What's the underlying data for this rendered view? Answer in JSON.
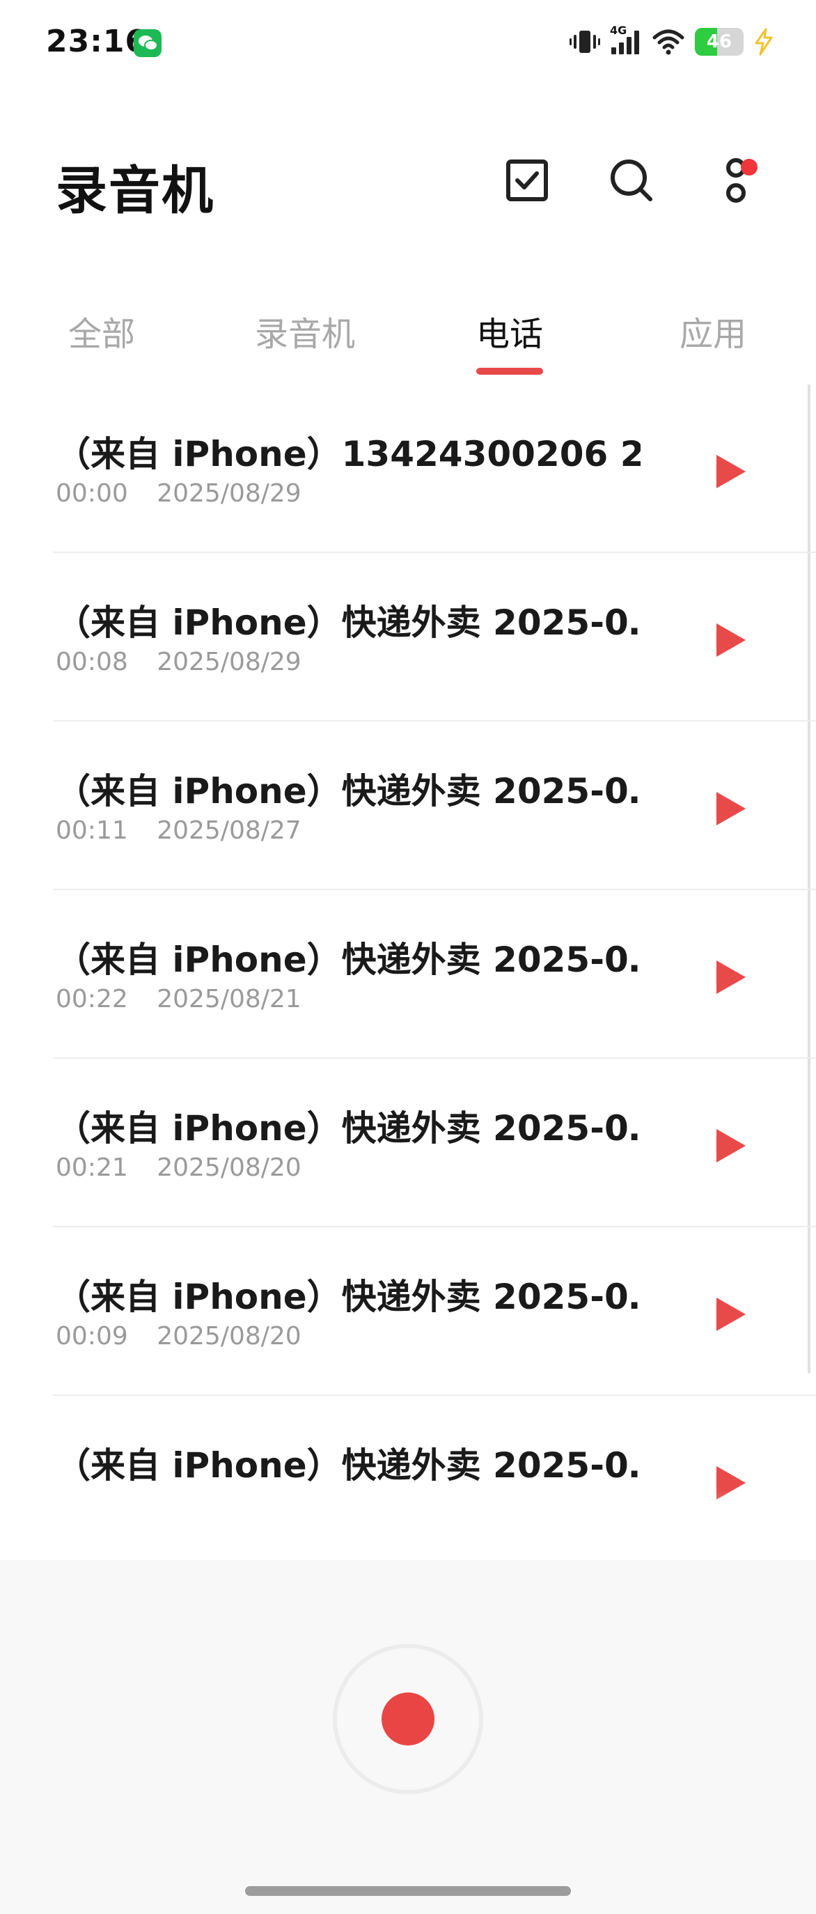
{
  "status_bar": {
    "time": "23:16",
    "network_label": "4G",
    "battery_level": "46",
    "battery_fraction": 0.46
  },
  "header": {
    "title": "录音机"
  },
  "tabs": [
    {
      "label": "全部",
      "active": false
    },
    {
      "label": "录音机",
      "active": false
    },
    {
      "label": "电话",
      "active": true
    },
    {
      "label": "应用",
      "active": false
    }
  ],
  "recordings": [
    {
      "title": "（来自 iPhone）13424300206 2…",
      "duration": "00:00",
      "date": "2025/08/29"
    },
    {
      "title": "（来自 iPhone）快递外卖 2025-0…",
      "duration": "00:08",
      "date": "2025/08/29"
    },
    {
      "title": "（来自 iPhone）快递外卖 2025-0…",
      "duration": "00:11",
      "date": "2025/08/27"
    },
    {
      "title": "（来自 iPhone）快递外卖 2025-0…",
      "duration": "00:22",
      "date": "2025/08/21"
    },
    {
      "title": "（来自 iPhone）快递外卖 2025-0…",
      "duration": "00:21",
      "date": "2025/08/20"
    },
    {
      "title": "（来自 iPhone）快递外卖 2025-0…",
      "duration": "00:09",
      "date": "2025/08/20"
    },
    {
      "title": "（来自 iPhone）快递外卖 2025-0…",
      "duration": "",
      "date": ""
    }
  ],
  "icons": {
    "select": "checkbox-icon",
    "search": "search-icon",
    "more": "more-vertical-icon",
    "play": "play-icon",
    "record": "record-icon"
  },
  "colors": {
    "accent": "#e84a4a",
    "record": "#e94545",
    "notification_dot": "#f0353b",
    "battery": "#2ecc40",
    "wechat": "#1db954"
  }
}
